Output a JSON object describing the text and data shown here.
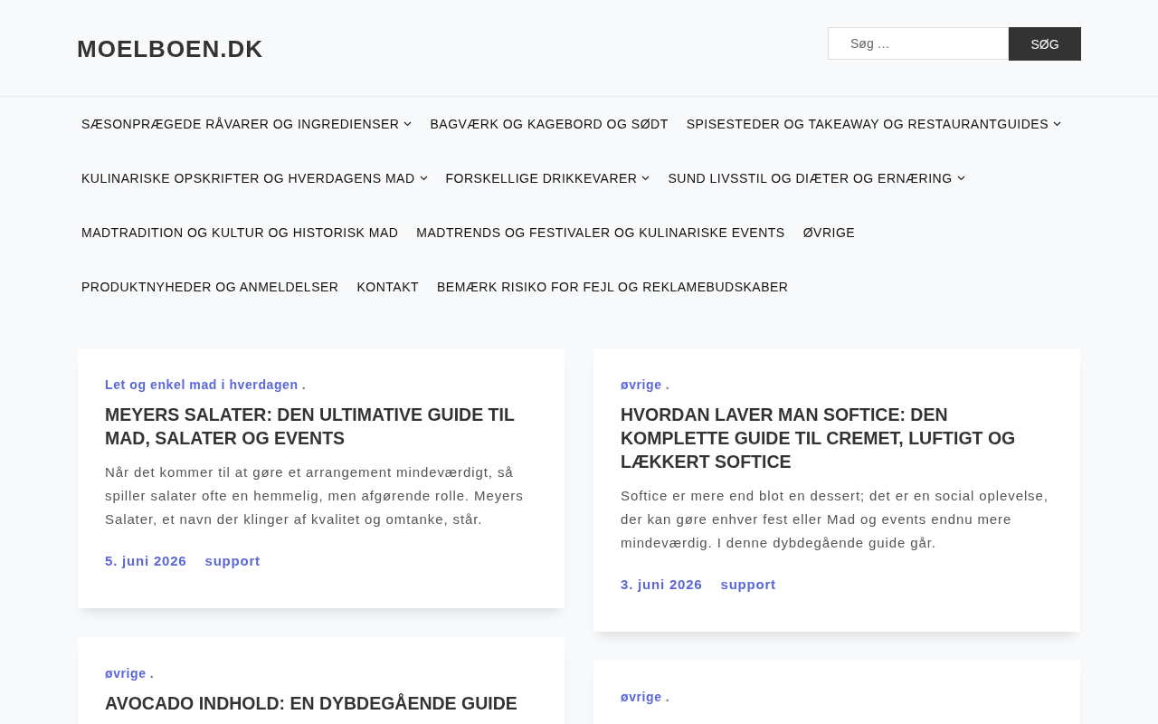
{
  "site_title": "MOELBOEN.DK",
  "search": {
    "placeholder": "Søg …",
    "button": "SØG"
  },
  "nav": [
    {
      "label": "SÆSONPRÆGEDE RÅVARER OG INGREDIENSER",
      "has_submenu": true
    },
    {
      "label": "BAGVÆRK OG KAGEBORD OG SØDT",
      "has_submenu": false
    },
    {
      "label": "SPISESTEDER OG TAKEAWAY OG RESTAURANTGUIDES",
      "has_submenu": true
    },
    {
      "label": "KULINARISKE OPSKRIFTER OG HVERDAGENS MAD",
      "has_submenu": true
    },
    {
      "label": "FORSKELLIGE DRIKKEVARER",
      "has_submenu": true
    },
    {
      "label": "SUND LIVSSTIL OG DIÆTER OG ERNÆRING",
      "has_submenu": true
    },
    {
      "label": "MADTRADITION OG KULTUR OG HISTORISK MAD",
      "has_submenu": false
    },
    {
      "label": "MADTRENDS OG FESTIVALER OG KULINARISKE EVENTS",
      "has_submenu": false
    },
    {
      "label": "ØVRIGE",
      "has_submenu": false
    },
    {
      "label": "PRODUKTNYHEDER OG ANMELDELSER",
      "has_submenu": false
    },
    {
      "label": "KONTAKT",
      "has_submenu": false
    },
    {
      "label": "BEMÆRK RISIKO FOR FEJL OG REKLAMEBUDSKABER",
      "has_submenu": false
    }
  ],
  "posts": [
    {
      "category": "Let og enkel mad i hverdagen",
      "separator": ".",
      "title": "MEYERS SALATER: DEN ULTIMATIVE GUIDE TIL MAD, SALATER OG EVENTS",
      "excerpt": "Når det kommer til at gøre et arrangement mindeværdigt, så spiller salater ofte en hemmelig, men afgørende rolle. Meyers Salater, et navn der klinger af kvalitet og omtanke, står.",
      "date": "5. juni 2026",
      "author": "support"
    },
    {
      "category": "øvrige",
      "separator": ".",
      "title": "HVORDAN LAVER MAN SOFTICE: DEN KOMPLETTE GUIDE TIL CREMET, LUFTIGT OG LÆKKERT SOFTICE",
      "excerpt": "Softice er mere end blot en dessert; det er en social oplevelse, der kan gøre enhver fest eller Mad og events endnu mere mindeværdig. I denne dybdegående guide går.",
      "date": "3. juni 2026",
      "author": "support"
    },
    {
      "category": "øvrige",
      "separator": ".",
      "title": "AVOCADO INDHOLD: EN DYBDEGÅENDE GUIDE"
    },
    {
      "category": "øvrige",
      "separator": "."
    }
  ]
}
